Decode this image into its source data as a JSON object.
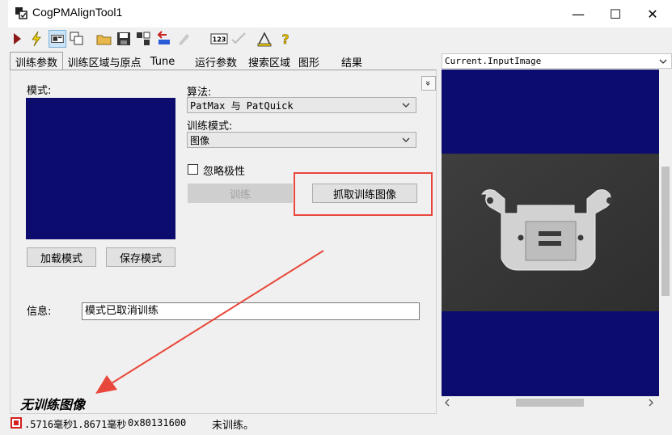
{
  "window": {
    "title": "CogPMAlignTool1"
  },
  "titlebar_controls": {
    "minimize": "—",
    "maximize": "☐",
    "close": "✕"
  },
  "tabs": [
    {
      "label": "训练参数",
      "active": true
    },
    {
      "label": "训练区域与原点"
    },
    {
      "label": "Tune"
    },
    {
      "label": "运行参数"
    },
    {
      "label": "搜索区域"
    },
    {
      "label": "图形"
    },
    {
      "label": "结果"
    }
  ],
  "panel": {
    "pattern_label": "模式:",
    "algorithm_label": "算法:",
    "algorithm_value": "PatMax 与 PatQuick",
    "train_mode_label": "训练模式:",
    "train_mode_value": "图像",
    "ignore_polarity_label": "忽略极性",
    "ignore_polarity_checked": false,
    "train_button": "训练",
    "grab_train_image_button": "抓取训练图像",
    "load_pattern_button": "加载模式",
    "save_pattern_button": "保存模式",
    "info_label": "信息:",
    "info_value": "模式已取消训练",
    "expand_glyph": "»"
  },
  "annotation": {
    "text": "无训练图像",
    "color": "#e84c3d"
  },
  "image_viewer": {
    "source": "Current.InputImage"
  },
  "statusbar": {
    "time1": ".5716毫秒",
    "time2": "1.8671毫秒",
    "code": "0x80131600",
    "state": "未训练。"
  },
  "colors": {
    "navy": "#0c0c6e",
    "highlight": "#e8473b"
  }
}
